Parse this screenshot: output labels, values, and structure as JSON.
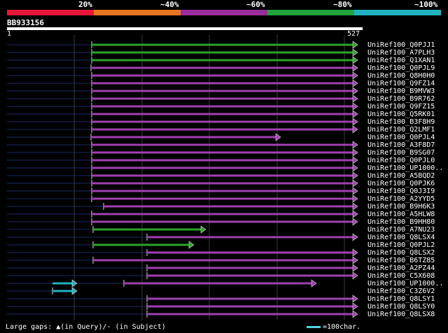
{
  "legend": {
    "labels": [
      "20%",
      "~40%",
      "~60%",
      "~80%",
      "~100%"
    ],
    "colors": [
      "#e8173a",
      "#e6761f",
      "#9b2c9b",
      "#23a33d",
      "#1fb3bf"
    ]
  },
  "query": {
    "id": "BB933156",
    "start": "1",
    "end": "527"
  },
  "hits": [
    {
      "label": "UniRef100_Q0PJJ1",
      "color": "#2aa52a"
    },
    {
      "label": "UniRef100_A7PLH3",
      "color": "#2aa52a"
    },
    {
      "label": "UniRef100_Q1XAN1",
      "color": "#2aa52a"
    },
    {
      "label": "UniRef100_Q0PJL9",
      "color": "#a040b0"
    },
    {
      "label": "UniRef100_Q8H0H0",
      "color": "#a040b0"
    },
    {
      "label": "UniRef100_Q9FZ14",
      "color": "#a040b0"
    },
    {
      "label": "UniRef100_B9MVW3",
      "color": "#a040b0"
    },
    {
      "label": "UniRef100_B9R762",
      "color": "#a040b0"
    },
    {
      "label": "UniRef100_Q9FZ15",
      "color": "#a040b0"
    },
    {
      "label": "UniRef100_Q5RK01",
      "color": "#a040b0"
    },
    {
      "label": "UniRef100_B3F8H9",
      "color": "#a040b0"
    },
    {
      "label": "UniRef100_Q2LMF1",
      "color": "#a040b0"
    },
    {
      "label": "UniRef100_Q0PJL4",
      "color": "#a040b0"
    },
    {
      "label": "UniRef100_A3F8D7",
      "color": "#a040b0"
    },
    {
      "label": "UniRef100_B9SG07",
      "color": "#a040b0"
    },
    {
      "label": "UniRef100_Q0PJL0",
      "color": "#a040b0"
    },
    {
      "label": "UniRef100_UP1000..",
      "color": "#a040b0"
    },
    {
      "label": "UniRef100_A5BQD2",
      "color": "#a040b0"
    },
    {
      "label": "UniRef100_Q0PJK6",
      "color": "#a040b0"
    },
    {
      "label": "UniRef100_Q0J3I9",
      "color": "#a040b0"
    },
    {
      "label": "UniRef100_A2YYD5",
      "color": "#a040b0"
    },
    {
      "label": "UniRef100_B9H6K3",
      "color": "#a040b0"
    },
    {
      "label": "UniRef100_A5HLW8",
      "color": "#a040b0"
    },
    {
      "label": "UniRef100_B9HH80",
      "color": "#a040b0"
    },
    {
      "label": "UniRef100_A7NU23",
      "color": "#2aa52a"
    },
    {
      "label": "UniRef100_Q8LSX4",
      "color": "#a040b0"
    },
    {
      "label": "UniRef100_Q0PJL2",
      "color": "#2aa52a"
    },
    {
      "label": "UniRef100_Q8LSX2",
      "color": "#a040b0"
    },
    {
      "label": "UniRef100_B6TZ85",
      "color": "#a040b0"
    },
    {
      "label": "UniRef100_A2PZ44",
      "color": "#a040b0"
    },
    {
      "label": "UniRef100_C5X608",
      "color": "#a040b0"
    },
    {
      "label": "UniRef100_UP1000..",
      "color": "#a040b0"
    },
    {
      "label": "UniRef100_C3Z6V2",
      "color": "#1fb3bf"
    },
    {
      "label": "UniRef100_Q8LSY1",
      "color": "#a040b0"
    },
    {
      "label": "UniRef100_Q8LSY0",
      "color": "#a040b0"
    },
    {
      "label": "UniRef100_Q8LSX8",
      "color": "#a040b0"
    }
  ],
  "footer": {
    "gaps_text": "Large gaps: ▲(in Query)/- (in Subject)",
    "scale_text": "=100char."
  }
}
